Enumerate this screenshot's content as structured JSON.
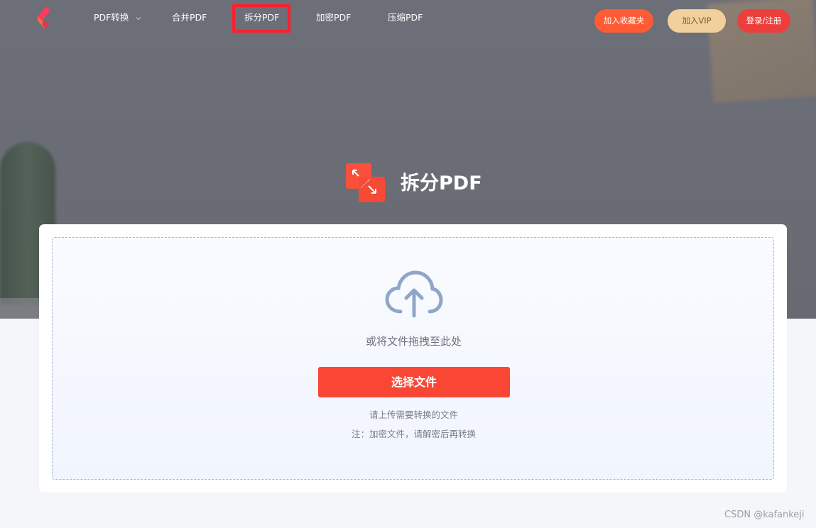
{
  "nav": {
    "items": [
      {
        "label": "PDF转换",
        "has_dropdown": true
      },
      {
        "label": "合并PDF"
      },
      {
        "label": "拆分PDF",
        "active": true
      },
      {
        "label": "加密PDF"
      },
      {
        "label": "压缩PDF"
      }
    ],
    "favorite_label": "加入收藏夹",
    "vip_label": "加入VIP",
    "login_label": "登录/注册"
  },
  "tool": {
    "title": "拆分PDF",
    "icon": "split-pdf-icon"
  },
  "upload": {
    "icon": "cloud-upload-icon",
    "drop_text": "或将文件拖拽至此处",
    "select_label": "选择文件",
    "hint_1": "请上传需要转换的文件",
    "hint_2": "注：加密文件，请解密后再转换"
  },
  "watermark": "CSDN @kafankeji",
  "colors": {
    "accent": "#fa4735",
    "highlight_box": "#ff1f2e",
    "vip": "#f1d09c",
    "cloud": "#8fa6c8"
  }
}
